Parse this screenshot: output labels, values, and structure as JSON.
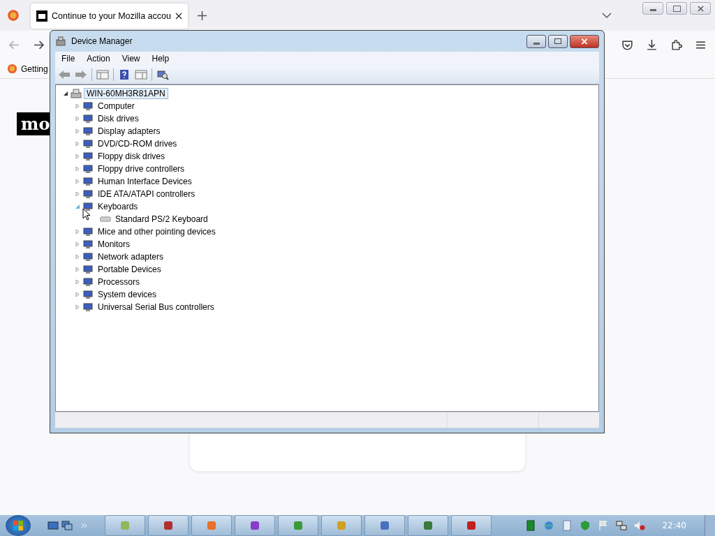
{
  "browser": {
    "tabs": [
      {
        "label": "Continue to your Mozilla accou",
        "selected": true
      }
    ],
    "bookmarks": [
      {
        "label": "Getting"
      }
    ],
    "page": {
      "logo": "mo"
    }
  },
  "device_manager": {
    "title": "Device Manager",
    "menu": [
      "File",
      "Action",
      "View",
      "Help"
    ],
    "tree": {
      "label": "WIN-60MH3R81APN",
      "expanded": true,
      "selected": true,
      "children": [
        {
          "label": "Computer",
          "expanded": false
        },
        {
          "label": "Disk drives",
          "expanded": false
        },
        {
          "label": "Display adapters",
          "expanded": false
        },
        {
          "label": "DVD/CD-ROM drives",
          "expanded": false
        },
        {
          "label": "Floppy disk drives",
          "expanded": false
        },
        {
          "label": "Floppy drive controllers",
          "expanded": false
        },
        {
          "label": "Human Interface Devices",
          "expanded": false
        },
        {
          "label": "IDE ATA/ATAPI controllers",
          "expanded": false
        },
        {
          "label": "Keyboards",
          "expanded": true,
          "children": [
            {
              "label": "Standard PS/2 Keyboard"
            }
          ]
        },
        {
          "label": "Mice and other pointing devices",
          "expanded": false
        },
        {
          "label": "Monitors",
          "expanded": false
        },
        {
          "label": "Network adapters",
          "expanded": false
        },
        {
          "label": "Portable Devices",
          "expanded": false
        },
        {
          "label": "Processors",
          "expanded": false
        },
        {
          "label": "System devices",
          "expanded": false
        },
        {
          "label": "Universal Serial Bus controllers",
          "expanded": false
        }
      ]
    }
  },
  "taskbar": {
    "clock": "22:40"
  }
}
